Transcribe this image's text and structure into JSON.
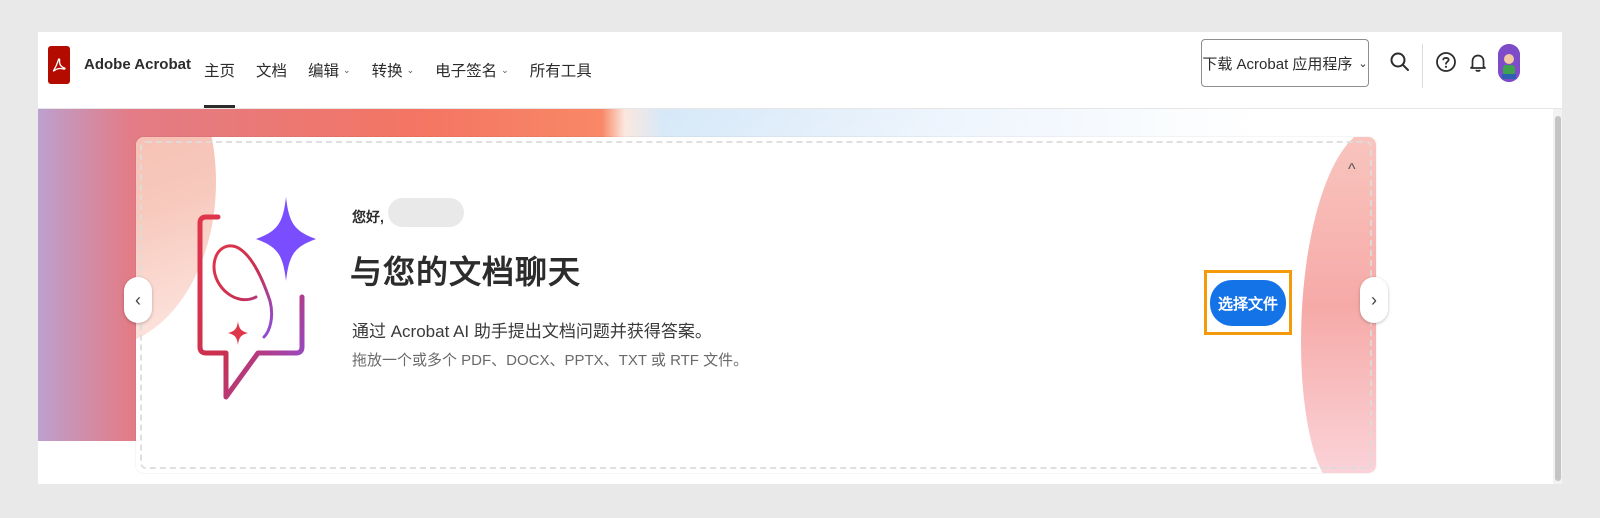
{
  "app": {
    "name": "Adobe Acrobat"
  },
  "nav": {
    "items": [
      {
        "label": "主页",
        "dropdown": false,
        "active": true
      },
      {
        "label": "文档",
        "dropdown": false,
        "active": false
      },
      {
        "label": "编辑",
        "dropdown": true,
        "active": false
      },
      {
        "label": "转换",
        "dropdown": true,
        "active": false
      },
      {
        "label": "电子签名",
        "dropdown": true,
        "active": false
      },
      {
        "label": "所有工具",
        "dropdown": false,
        "active": false
      }
    ],
    "chevron_glyph": "⌄"
  },
  "toolbar": {
    "download_label": "下载 Acrobat 应用程序",
    "download_chevron": "⌄",
    "icons": [
      "search-icon",
      "help-icon",
      "bell-icon",
      "avatar"
    ]
  },
  "hero": {
    "greeting": "您好,",
    "headline": "与您的文档聊天",
    "subtitle": "通过 Acrobat AI 助手提出文档问题并获得答案。",
    "hint": "拖放一个或多个 PDF、DOCX、PPTX、TXT 或 RTF 文件。",
    "select_button": "选择文件",
    "collapse_glyph": "^",
    "prev_glyph": "‹",
    "next_glyph": "›"
  },
  "colors": {
    "brand_red": "#b30b00",
    "primary_blue": "#1473e6",
    "highlight_orange": "#f59a0a",
    "sparkle_purple": "#7a4dff"
  }
}
